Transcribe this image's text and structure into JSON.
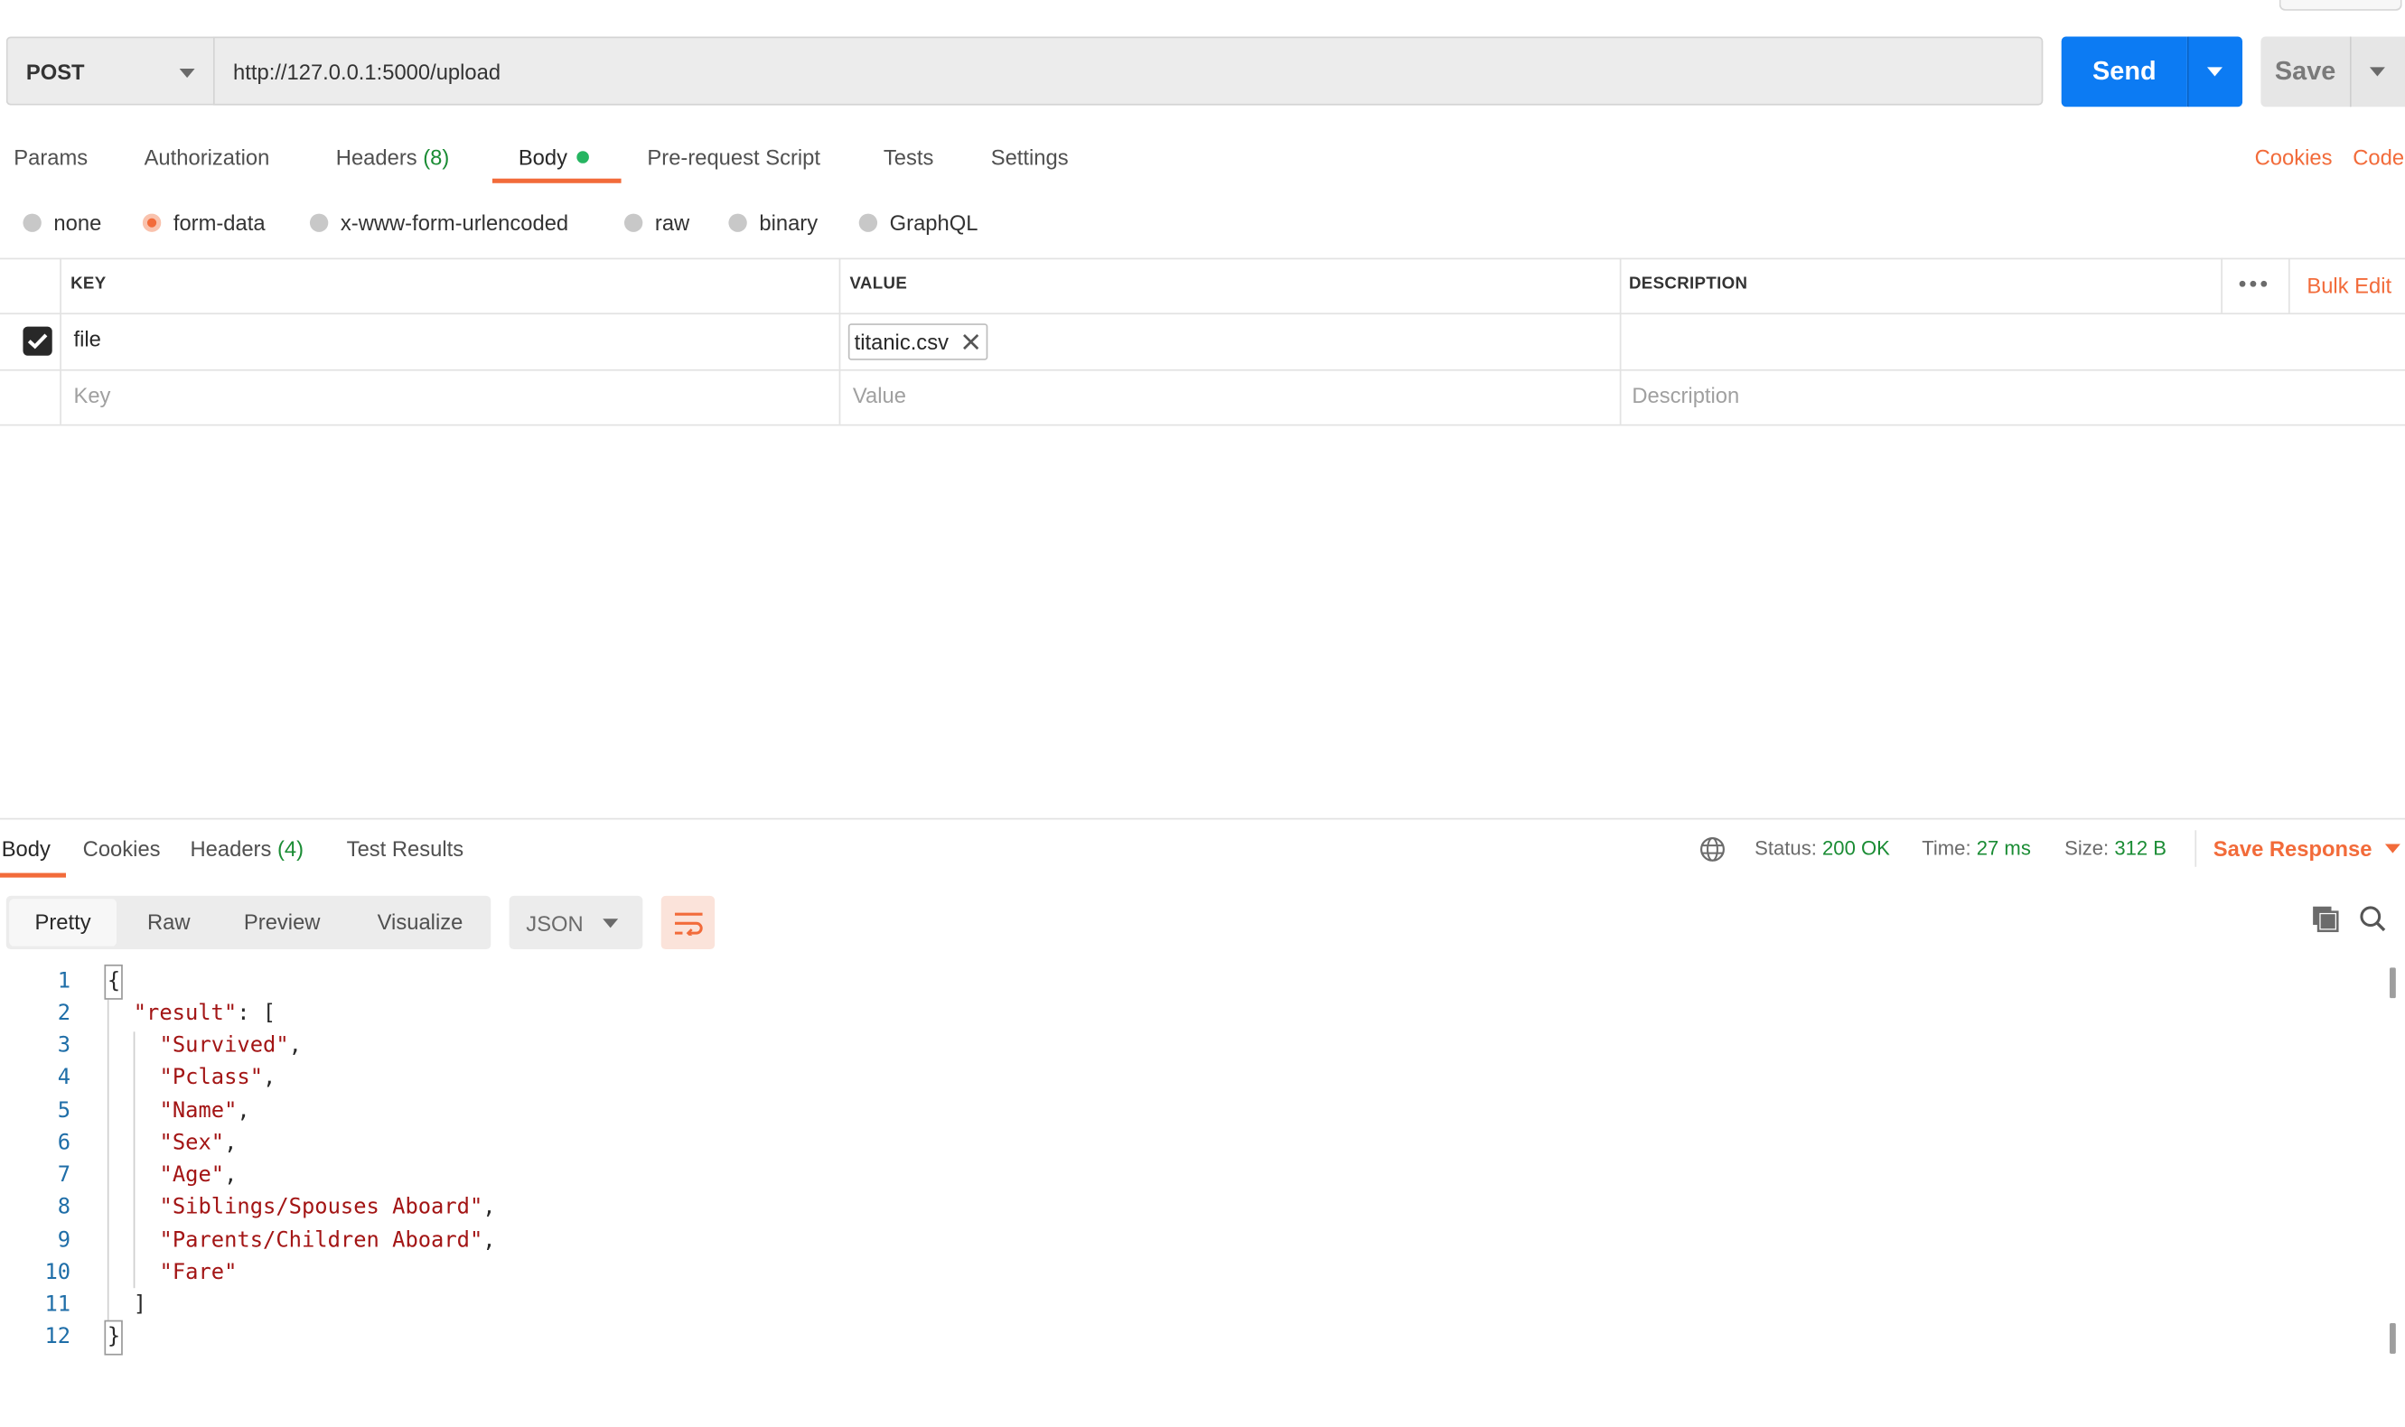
{
  "request": {
    "method": "POST",
    "url": "http://127.0.0.1:5000/upload",
    "send_label": "Send",
    "save_label": "Save"
  },
  "request_tabs": {
    "params": "Params",
    "authorization": "Authorization",
    "headers": "Headers",
    "headers_count": "(8)",
    "body": "Body",
    "pre_request": "Pre-request Script",
    "tests": "Tests",
    "settings": "Settings",
    "cookies": "Cookies",
    "code": "Code"
  },
  "body_types": {
    "none": "none",
    "form_data": "form-data",
    "urlencoded": "x-www-form-urlencoded",
    "raw": "raw",
    "binary": "binary",
    "graphql": "GraphQL",
    "selected": "form-data"
  },
  "form_table": {
    "headers": {
      "key": "KEY",
      "value": "VALUE",
      "description": "DESCRIPTION"
    },
    "bulk_edit": "Bulk Edit",
    "rows": [
      {
        "checked": true,
        "key": "file",
        "value": "titanic.csv",
        "description": ""
      }
    ],
    "placeholders": {
      "key": "Key",
      "value": "Value",
      "description": "Description"
    }
  },
  "response": {
    "tabs": {
      "body": "Body",
      "cookies": "Cookies",
      "headers": "Headers",
      "headers_count": "(4)",
      "test_results": "Test Results"
    },
    "status_label": "Status:",
    "status_value": "200 OK",
    "time_label": "Time:",
    "time_value": "27 ms",
    "size_label": "Size:",
    "size_value": "312 B",
    "save_response": "Save Response",
    "views": {
      "pretty": "Pretty",
      "raw": "Raw",
      "preview": "Preview",
      "visualize": "Visualize"
    },
    "format": "JSON"
  },
  "code": {
    "line_numbers": [
      "1",
      "2",
      "3",
      "4",
      "5",
      "6",
      "7",
      "8",
      "9",
      "10",
      "11",
      "12"
    ],
    "open_brace": "{",
    "key": "\"result\"",
    "colon_bracket": ": [",
    "items": [
      "\"Survived\"",
      "\"Pclass\"",
      "\"Name\"",
      "\"Sex\"",
      "\"Age\"",
      "\"Siblings/Spouses Aboard\"",
      "\"Parents/Children Aboard\"",
      "\"Fare\""
    ],
    "close_bracket": "]",
    "close_brace": "}"
  },
  "colors": {
    "accent": "#f26b3a",
    "send": "#0c7bf3",
    "success": "#1a8c34",
    "string": "#a31515",
    "line_number": "#1f6ea8"
  }
}
